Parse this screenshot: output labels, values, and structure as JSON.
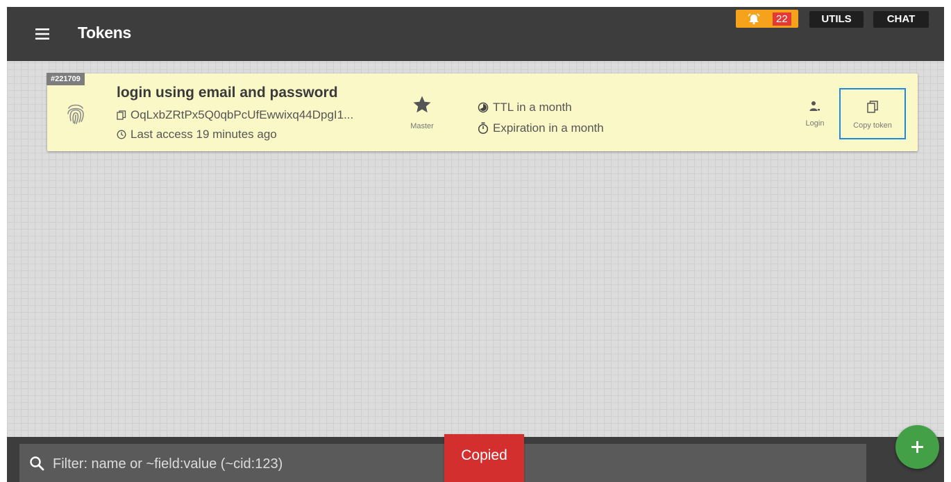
{
  "header": {
    "menu_icon": "hamburger-menu-icon",
    "title": "Tokens",
    "alarm": {
      "icon": "alarm-bell-icon",
      "count": "22",
      "color": "#f7a21b",
      "count_color": "#e53935"
    },
    "buttons": {
      "utils": "UTILS",
      "chat": "CHAT"
    }
  },
  "token": {
    "id": "#221709",
    "icon": "fingerprint-icon",
    "title": "login using email and password",
    "value_icon": "copy-icon",
    "value": "OqLxbZRtPx5Q0qbPcUfEwwixq44DpgI1...",
    "access_icon": "clock-icon",
    "last_access": "Last access 19 minutes ago",
    "master_icon": "star-icon",
    "master_label": "Master",
    "ttl_icon": "timelapse-icon",
    "ttl": "TTL in a month",
    "expiration_icon": "timer-icon",
    "expiration": "Expiration in a month",
    "actions": {
      "login": {
        "icon": "person-login-icon",
        "label": "Login"
      },
      "copy": {
        "icon": "copy-icon",
        "label": "Copy token"
      }
    },
    "card_color": "#fbf8c7"
  },
  "filter": {
    "icon": "search-icon",
    "placeholder": "Filter: name or ~field:value (~cid:123)"
  },
  "toast": {
    "text": "Copied",
    "color": "#d32f2f"
  },
  "fab": {
    "icon": "plus-icon",
    "color": "#43a047"
  }
}
